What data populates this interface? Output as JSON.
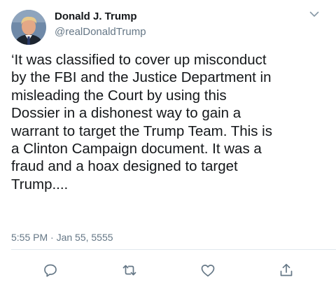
{
  "author": {
    "display_name": "Donald J. Trump",
    "handle": "@realDonaldTrump",
    "avatar_icon": "profile-photo"
  },
  "tweet": {
    "text": "‘It was classified to cover up misconduct\nby the FBI and the Justice Department in\nmisleading the Court by using this\nDossier in a dishonest way to gain a\nwarrant to target the Trump Team. This is\na Clinton Campaign document. It was a\nfraud and a hoax designed to target\nTrump....",
    "timestamp": "5:55 PM · Jan 55, 5555"
  },
  "actions": [
    {
      "name": "reply",
      "icon": "speech-bubble-icon"
    },
    {
      "name": "retweet",
      "icon": "retweet-arrows-icon"
    },
    {
      "name": "like",
      "icon": "heart-icon"
    },
    {
      "name": "share",
      "icon": "upload-arrow-icon"
    }
  ],
  "colors": {
    "text_primary": "#14171a",
    "text_secondary": "#657786",
    "icon": "#657786",
    "divider": "#e1e8ed"
  }
}
